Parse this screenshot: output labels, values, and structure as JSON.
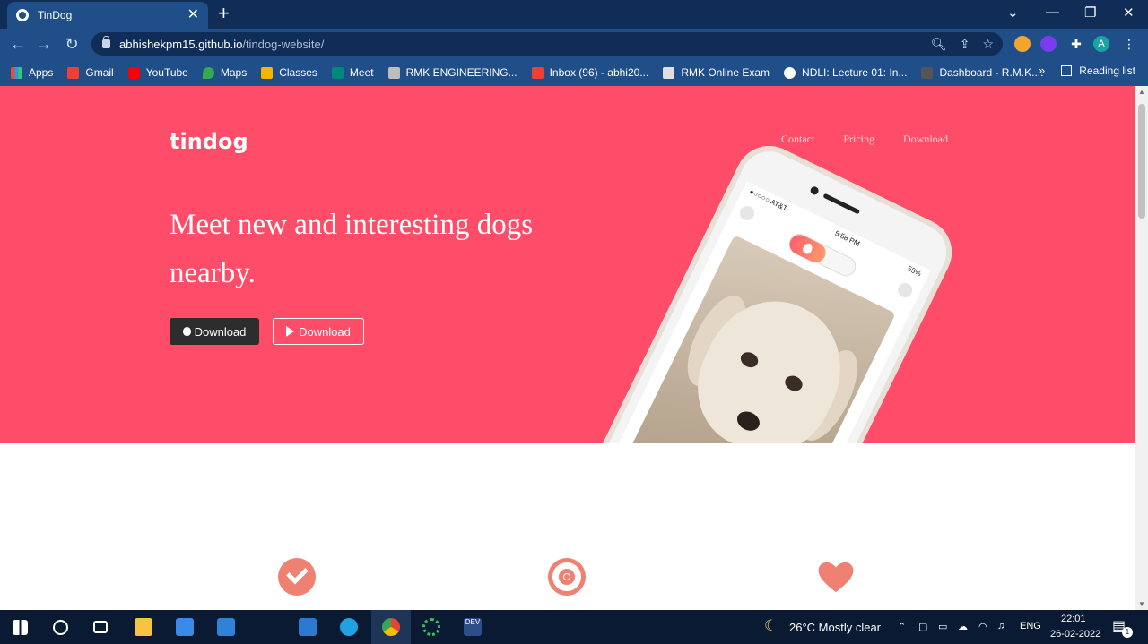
{
  "browser": {
    "tab_title": "TinDog",
    "new_tab": "+",
    "url_host": "abhishekpm15.github.io",
    "url_path": "/tindog-website/",
    "bookmarks": [
      {
        "label": "Apps"
      },
      {
        "label": "Gmail"
      },
      {
        "label": "YouTube"
      },
      {
        "label": "Maps"
      },
      {
        "label": "Classes"
      },
      {
        "label": "Meet"
      },
      {
        "label": "RMK ENGINEERING..."
      },
      {
        "label": "Inbox (96) - abhi20..."
      },
      {
        "label": "RMK Online Exam"
      },
      {
        "label": "NDLI: Lecture 01: In..."
      },
      {
        "label": "Dashboard - R.M.K...."
      }
    ],
    "more_bookmarks": "»",
    "reading_list": "Reading list",
    "profile_initial": "A"
  },
  "site": {
    "brand": "tindog",
    "nav": [
      "Contact",
      "Pricing",
      "Download"
    ],
    "headline": "Meet new and interesting dogs nearby.",
    "btn_apple": "Download",
    "btn_play": "Download",
    "phone": {
      "carrier": "●○○○○ AT&T",
      "time": "5:58 PM",
      "battery": "55%"
    }
  },
  "taskbar": {
    "weather": "26°C  Mostly clear",
    "lang": "ENG",
    "time": "22:01",
    "date": "26-02-2022",
    "notif_count": "1"
  }
}
